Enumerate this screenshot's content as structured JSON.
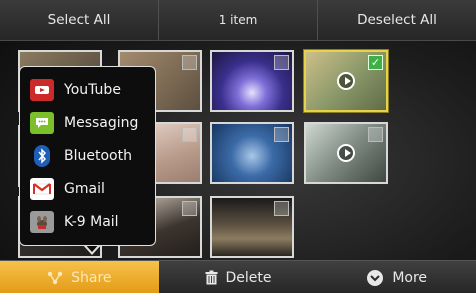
{
  "topbar": {
    "select_all": "Select All",
    "count": "1 item",
    "deselect_all": "Deselect All"
  },
  "share_menu": {
    "items": [
      {
        "label": "YouTube",
        "icon": "youtube-icon"
      },
      {
        "label": "Messaging",
        "icon": "messaging-icon"
      },
      {
        "label": "Bluetooth",
        "icon": "bluetooth-icon"
      },
      {
        "label": "Gmail",
        "icon": "gmail-icon"
      },
      {
        "label": "K-9 Mail",
        "icon": "k9-mail-icon"
      }
    ]
  },
  "bottombar": {
    "share": "Share",
    "delete": "Delete",
    "more": "More"
  },
  "colors": {
    "accent": "#e39a16",
    "selected_border": "#e6d34a",
    "check_on": "#3fb045"
  }
}
